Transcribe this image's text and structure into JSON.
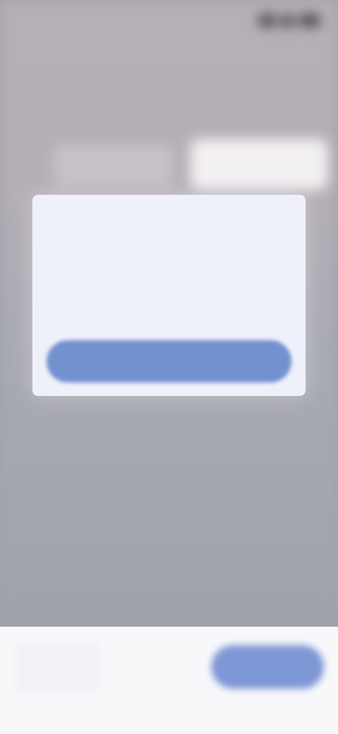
{
  "status_bar": {
    "time": "",
    "icons": [
      "signal-icon",
      "wifi-icon",
      "battery-icon"
    ]
  },
  "page": {
    "title": "",
    "subtitle": "",
    "section_title": "",
    "options": [
      "",
      ""
    ]
  },
  "dialog": {
    "title": "",
    "body": "",
    "button_label": ""
  },
  "bottom_bar": {
    "back_label": "",
    "next_label": ""
  },
  "colors": {
    "accent": "#7491cf",
    "dialog_background": "#eef1fa",
    "overlay": "#a0a2ab",
    "bottom_bar_background": "#f8f8fb"
  }
}
